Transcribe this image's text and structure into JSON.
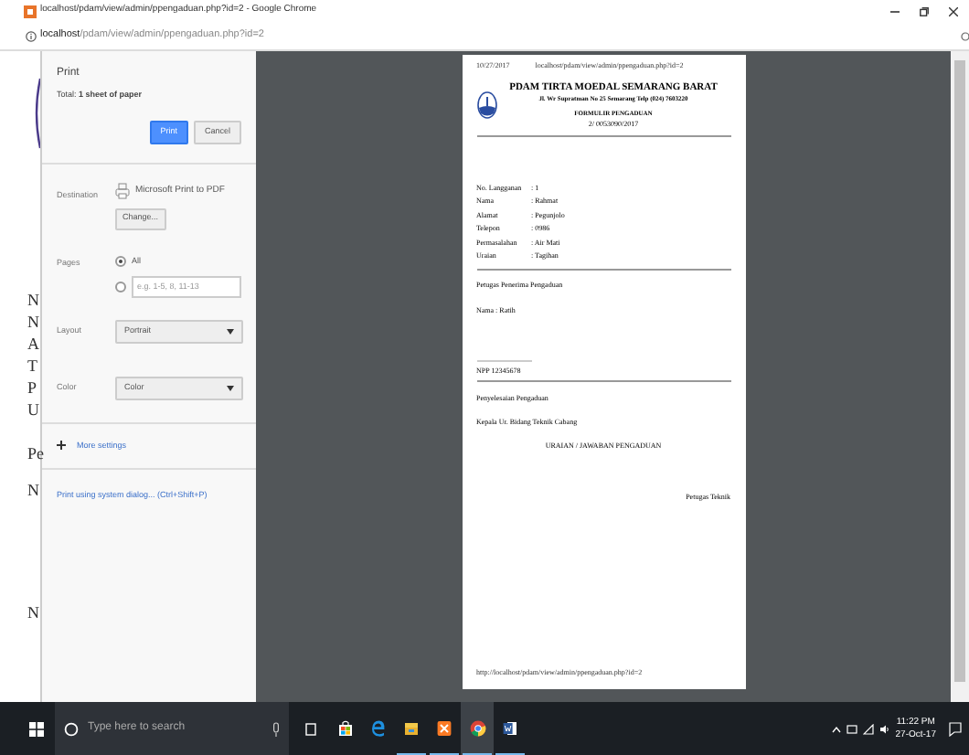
{
  "window": {
    "title": "localhost/pdam/view/admin/ppengaduan.php?id=2 - Google Chrome"
  },
  "address_bar": {
    "host": "localhost",
    "path": "/pdam/view/admin/ppengaduan.php?id=2"
  },
  "background_page": {
    "letters": [
      "N",
      "N",
      "A",
      "T",
      "P",
      "U",
      "Pe",
      "N",
      "N"
    ]
  },
  "print_panel": {
    "title": "Print",
    "total": "Total: **1 sheet of paper**",
    "buttons": [
      {
        "label": "Print",
        "kind": "primary"
      },
      {
        "label": "Cancel",
        "kind": "secondary"
      }
    ],
    "destination": {
      "label": "Destination",
      "printer": "Microsoft Print to PDF",
      "change_button": "Change..."
    },
    "pages": {
      "label": "Pages",
      "options": [
        {
          "kind": "all",
          "label": "All",
          "selected": true
        },
        {
          "kind": "range",
          "placeholder": "e.g. 1-5, 8, 11-13",
          "selected": false
        }
      ]
    },
    "layout": {
      "label": "Layout",
      "value": "Portrait"
    },
    "color": {
      "label": "Color",
      "value": "Color"
    },
    "more_settings": "More settings",
    "system_dialog_link": "Print using system dialog... (Ctrl+Shift+P)"
  },
  "preview": {
    "header_date": "10/27/2017",
    "header_url": "localhost/pdam/view/admin/ppengaduan.php?id=2",
    "org": "PDAM TIRTA MOEDAL SEMARANG BARAT",
    "address": "Jl. Wr Supratman No 25 Semarang Telp (024) 7603220",
    "form_title": "FORMULIR PENGADUAN",
    "form_number": "2/ 0053090/2017",
    "fields": [
      {
        "label": "No. Langganan",
        "value": ": 1"
      },
      {
        "label": "Nama",
        "value": ": Rahmat"
      },
      {
        "label": "Alamat",
        "value": ": Pegunjolo"
      },
      {
        "label": "Telepon",
        "value": ": 0986"
      },
      {
        "label": "Permasalahan",
        "value": ": Air Mati"
      },
      {
        "label": "Uraian",
        "value": ": Tagihan"
      }
    ],
    "receiver_title": "Petugas Penerima Pengaduan",
    "receiver_name": "Nama : Ratih",
    "npp": "NPP 12345678",
    "resolution_title": "Penyelesaian Pengaduan",
    "head_title": "Kepala Ur. Bidang Teknik Cabang",
    "answer_title": "URAIAN / JAWABAN PENGADUAN",
    "technician": "Petugas Teknik",
    "footer_url": "http://localhost/pdam/view/admin/ppengaduan.php?id=2"
  },
  "taskbar": {
    "search_placeholder": "Type here to search",
    "apps": [
      {
        "kind": "store",
        "running": false,
        "active": false
      },
      {
        "kind": "edge",
        "running": false,
        "active": false
      },
      {
        "kind": "explorer",
        "running": true,
        "active": false
      },
      {
        "kind": "xampp",
        "running": true,
        "active": false
      },
      {
        "kind": "chrome",
        "running": true,
        "active": true
      },
      {
        "kind": "word",
        "running": true,
        "active": false
      }
    ],
    "time": "11:22 PM",
    "date": "27-Oct-17"
  }
}
